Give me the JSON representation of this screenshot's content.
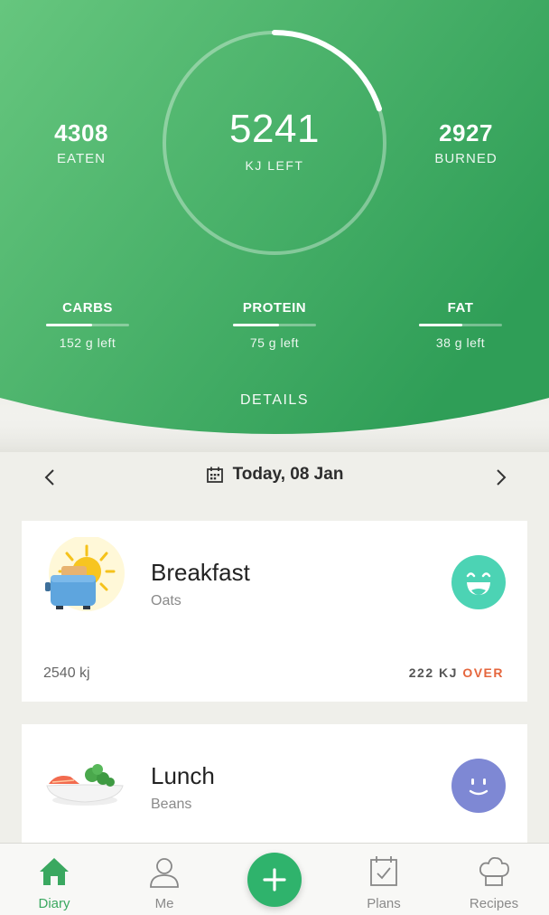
{
  "summary": {
    "eaten_value": "4308",
    "eaten_label": "EATEN",
    "left_value": "5241",
    "left_label": "KJ LEFT",
    "burned_value": "2927",
    "burned_label": "BURNED",
    "ring_progress": 0.2,
    "details_label": "DETAILS"
  },
  "macros": [
    {
      "name": "CARBS",
      "left": "152 g left",
      "progress": 0.55
    },
    {
      "name": "PROTEIN",
      "left": "75 g left",
      "progress": 0.55
    },
    {
      "name": "FAT",
      "left": "38 g left",
      "progress": 0.52
    }
  ],
  "date": {
    "label": "Today, 08 Jan"
  },
  "meals": [
    {
      "title": "Breakfast",
      "subtitle": "Oats",
      "kj": "2540 kj",
      "status_amount": "222 KJ",
      "status_word": "OVER",
      "mood_color": "#4cd3b4"
    },
    {
      "title": "Lunch",
      "subtitle": "Beans",
      "mood_color": "#7e88d4"
    }
  ],
  "tabs": {
    "diary": "Diary",
    "me": "Me",
    "plans": "Plans",
    "recipes": "Recipes"
  },
  "colors": {
    "brand_green": "#3aa860",
    "over_red": "#e5663d"
  }
}
